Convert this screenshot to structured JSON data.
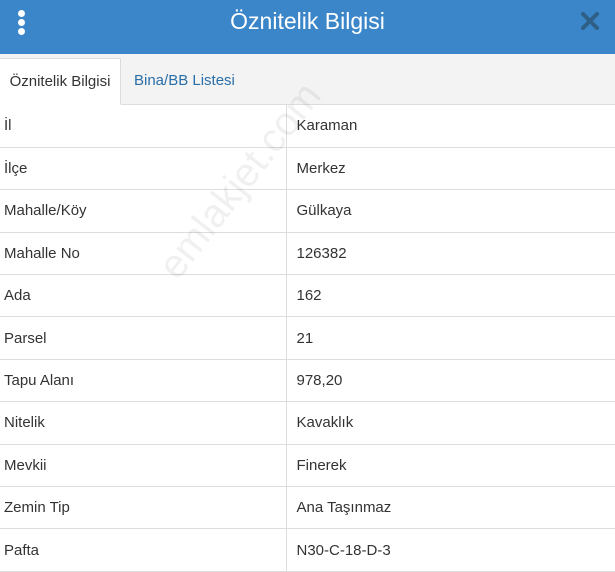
{
  "header": {
    "title": "Öznitelik Bilgisi",
    "menu_icon": "vertical-ellipsis-icon",
    "close_icon": "close-icon",
    "background_color": "#3a86c8"
  },
  "tabs": [
    {
      "label": "Öznitelik Bilgisi",
      "active": true
    },
    {
      "label": "Bina/BB Listesi",
      "active": false
    }
  ],
  "rows": [
    {
      "key": "İl",
      "value": "Karaman"
    },
    {
      "key": "İlçe",
      "value": "Merkez"
    },
    {
      "key": "Mahalle/Köy",
      "value": "Gülkaya"
    },
    {
      "key": "Mahalle No",
      "value": "126382"
    },
    {
      "key": "Ada",
      "value": "162"
    },
    {
      "key": "Parsel",
      "value": "21"
    },
    {
      "key": "Tapu Alanı",
      "value": "978,20"
    },
    {
      "key": "Nitelik",
      "value": "Kavaklık"
    },
    {
      "key": "Mevkii",
      "value": "Finerek"
    },
    {
      "key": "Zemin Tip",
      "value": "Ana Taşınmaz"
    },
    {
      "key": "Pafta",
      "value": "N30-C-18-D-3"
    }
  ],
  "watermark": "emlakjet.com"
}
